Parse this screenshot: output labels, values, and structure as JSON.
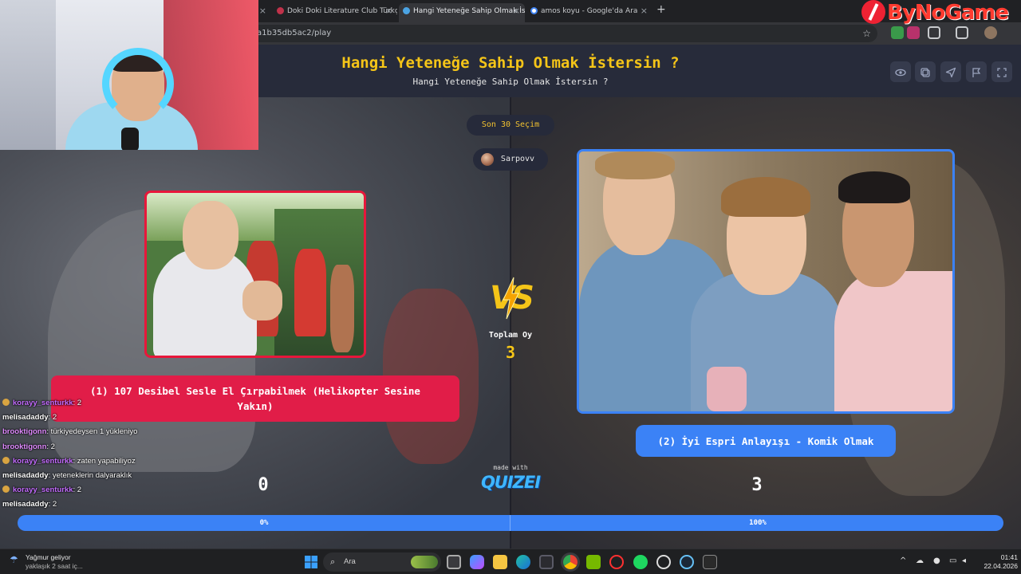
{
  "browser": {
    "tabs": [
      {
        "label": "",
        "active": false
      },
      {
        "label": "Doki Doki Literature Club Türkç",
        "active": false
      },
      {
        "label": "Hangi Yeteneğe Sahip Olmak İs",
        "active": true
      },
      {
        "label": "amos koyu - Google'da Ara",
        "active": false
      }
    ],
    "close_glyph": "×",
    "new_tab_glyph": "+",
    "url": "a1b35db5ac2/play"
  },
  "brand": {
    "text": "ByNoGame"
  },
  "header": {
    "title": "Hangi Yeteneğe Sahip Olmak İstersin ?",
    "subtitle": "Hangi Yeteneğe Sahip Olmak İstersin ?",
    "buttons": [
      "eye-icon",
      "copy-icon",
      "send-icon",
      "flag-icon",
      "fullscreen-icon"
    ]
  },
  "game": {
    "last_choices": "Son 30 Seçim",
    "player": "Sarpovv",
    "vs": "VS",
    "total_label": "Toplam Oy",
    "total_votes": "3",
    "option_left": {
      "label": "(1) 107 Desibel Sesle El Çırpabilmek (Helikopter Sesine Yakın)",
      "votes": "0",
      "percent_label": "0%",
      "percent": 0
    },
    "option_right": {
      "label": "(2) İyi Espri Anlayışı - Komik Olmak",
      "votes": "3",
      "percent_label": "100%",
      "percent": 100
    },
    "made_with": "made with",
    "logo": "QUIZEI"
  },
  "chat": [
    {
      "user": "korayy_senturkk",
      "msg": ": 2",
      "color": "#c46cff",
      "badge": true
    },
    {
      "user": "melisadaddy",
      "msg": ": 2",
      "color": "#ffffff",
      "badge": false
    },
    {
      "user": "brooktigonn",
      "msg": ": türkiyedeysen 1 yükleniyo",
      "color": "#e08bff",
      "badge": false
    },
    {
      "user": "brooktigonn",
      "msg": ": 2",
      "color": "#e08bff",
      "badge": false
    },
    {
      "user": "korayy_senturkk",
      "msg": ": zaten yapabiliyoz",
      "color": "#c46cff",
      "badge": true
    },
    {
      "user": "melisadaddy",
      "msg": ": yeteneklerin dalyaraklık",
      "color": "#ffffff",
      "badge": false
    },
    {
      "user": "korayy_senturkk",
      "msg": ": 2",
      "color": "#c46cff",
      "badge": true
    },
    {
      "user": "melisadaddy",
      "msg": ": 2",
      "color": "#ffffff",
      "badge": false
    }
  ],
  "taskbar": {
    "weather_title": "Yağmur geliyor",
    "weather_sub": "yaklaşık 2 saat iç...",
    "search_placeholder": "Ara",
    "time": "01:41",
    "date": "22.04.2026"
  },
  "colors": {
    "red": "#e11d48",
    "blue": "#3b82f6",
    "gold": "#f5c518"
  }
}
